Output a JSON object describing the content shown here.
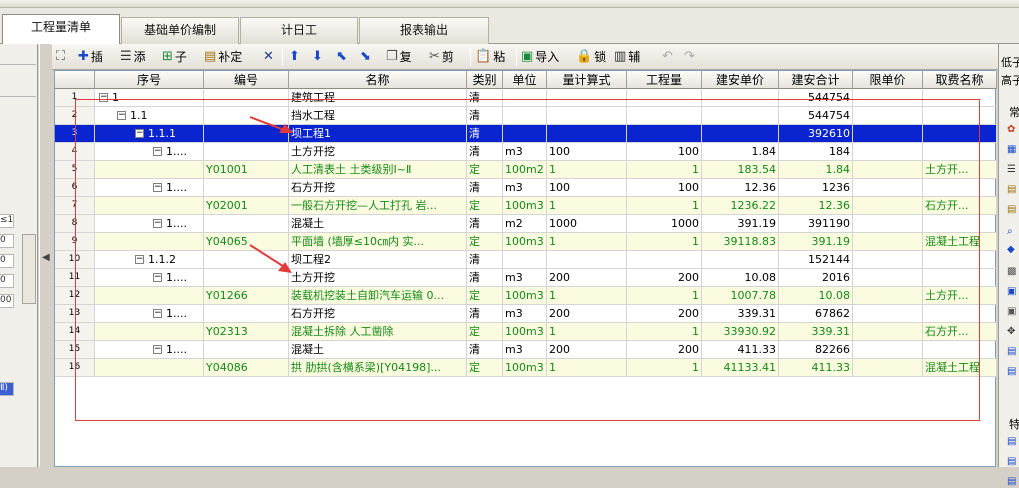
{
  "tabs": [
    {
      "label": "工程量清单"
    },
    {
      "label": "基础单价编制"
    },
    {
      "label": "计日工"
    },
    {
      "label": "报表输出"
    }
  ],
  "left_rows": [
    "≤1(",
    "0㎝",
    "0㎝",
    "0㎝",
    "00",
    "Ⅱ)"
  ],
  "toolbar": {
    "insert": "插",
    "add": "添",
    "child": "子",
    "supplement": "补定",
    "copy": "复",
    "cut": "剪",
    "paste": "粘",
    "import": "导入",
    "lock": "锁",
    "aux": "辅"
  },
  "headers": [
    "序号",
    "编号",
    "名称",
    "类别",
    "单位",
    "量计算式",
    "工程量",
    "建安单价",
    "建安合计",
    "限单价",
    "取费名称"
  ],
  "rows": [
    {
      "n": "1",
      "seq": "1",
      "code": "",
      "name": "建筑工程",
      "cat": "清",
      "unit": "",
      "formula": "",
      "qty": "",
      "price": "",
      "total": "544754",
      "fee": "",
      "type": "q",
      "lvl": 0
    },
    {
      "n": "2",
      "seq": "1.1",
      "code": "",
      "name": "挡水工程",
      "cat": "清",
      "unit": "",
      "formula": "",
      "qty": "",
      "price": "",
      "total": "544754",
      "fee": "",
      "type": "q",
      "lvl": 1
    },
    {
      "n": "3",
      "seq": "1.1.1",
      "code": "",
      "name": "坝工程1",
      "cat": "清",
      "unit": "",
      "formula": "",
      "qty": "",
      "price": "",
      "total": "392610",
      "fee": "",
      "type": "sel",
      "lvl": 2
    },
    {
      "n": "4",
      "seq": "1....",
      "code": "",
      "name": "土方开挖",
      "cat": "清",
      "unit": "m3",
      "formula": "100",
      "qty": "100",
      "price": "1.84",
      "total": "184",
      "fee": "",
      "type": "q",
      "lvl": 3
    },
    {
      "n": "5",
      "seq": "",
      "code": "Y01001",
      "name": "人工清表土 土类级别Ⅰ~Ⅱ",
      "cat": "定",
      "unit": "100m2",
      "formula": "1",
      "qty": "1",
      "price": "183.54",
      "total": "1.84",
      "fee": "土方开...",
      "type": "d",
      "lvl": 4
    },
    {
      "n": "6",
      "seq": "1....",
      "code": "",
      "name": "石方开挖",
      "cat": "清",
      "unit": "m3",
      "formula": "100",
      "qty": "100",
      "price": "12.36",
      "total": "1236",
      "fee": "",
      "type": "q",
      "lvl": 3
    },
    {
      "n": "7",
      "seq": "",
      "code": "Y02001",
      "name": "一般石方开挖—人工打孔 岩...",
      "cat": "定",
      "unit": "100m3",
      "formula": "1",
      "qty": "1",
      "price": "1236.22",
      "total": "12.36",
      "fee": "石方开...",
      "type": "d",
      "lvl": 4
    },
    {
      "n": "8",
      "seq": "1....",
      "code": "",
      "name": "混凝土",
      "cat": "清",
      "unit": "m2",
      "formula": "1000",
      "qty": "1000",
      "price": "391.19",
      "total": "391190",
      "fee": "",
      "type": "q",
      "lvl": 3
    },
    {
      "n": "9",
      "seq": "",
      "code": "Y04065",
      "name": "平面墙 (墙厚≤10㎝内 实...",
      "cat": "定",
      "unit": "100m3",
      "formula": "1",
      "qty": "1",
      "price": "39118.83",
      "total": "391.19",
      "fee": "混凝土工程",
      "type": "d",
      "lvl": 4
    },
    {
      "n": "10",
      "seq": "1.1.2",
      "code": "",
      "name": "坝工程2",
      "cat": "清",
      "unit": "",
      "formula": "",
      "qty": "",
      "price": "",
      "total": "152144",
      "fee": "",
      "type": "q",
      "lvl": 2
    },
    {
      "n": "11",
      "seq": "1....",
      "code": "",
      "name": "土方开挖",
      "cat": "清",
      "unit": "m3",
      "formula": "200",
      "qty": "200",
      "price": "10.08",
      "total": "2016",
      "fee": "",
      "type": "q",
      "lvl": 3
    },
    {
      "n": "12",
      "seq": "",
      "code": "Y01266",
      "name": "装载机挖装土自卸汽车运输 0...",
      "cat": "定",
      "unit": "100m3",
      "formula": "1",
      "qty": "1",
      "price": "1007.78",
      "total": "10.08",
      "fee": "土方开...",
      "type": "d",
      "lvl": 4
    },
    {
      "n": "13",
      "seq": "1....",
      "code": "",
      "name": "石方开挖",
      "cat": "清",
      "unit": "m3",
      "formula": "200",
      "qty": "200",
      "price": "339.31",
      "total": "67862",
      "fee": "",
      "type": "q",
      "lvl": 3
    },
    {
      "n": "14",
      "seq": "",
      "code": "Y02313",
      "name": "混凝土拆除 人工凿除",
      "cat": "定",
      "unit": "100m3",
      "formula": "1",
      "qty": "1",
      "price": "33930.92",
      "total": "339.31",
      "fee": "石方开...",
      "type": "d",
      "lvl": 4
    },
    {
      "n": "15",
      "seq": "1....",
      "code": "",
      "name": "混凝土",
      "cat": "清",
      "unit": "m3",
      "formula": "200",
      "qty": "200",
      "price": "411.33",
      "total": "82266",
      "fee": "",
      "type": "q",
      "lvl": 3
    },
    {
      "n": "16",
      "seq": "",
      "code": "Y04086",
      "name": "拱 肋拱(含横系梁)[Y04198]...",
      "cat": "定",
      "unit": "100m3",
      "formula": "1",
      "qty": "1",
      "price": "41133.41",
      "total": "411.33",
      "fee": "混凝土工程",
      "type": "d",
      "lvl": 4
    }
  ],
  "right_panel": {
    "line1": "低子",
    "line2": "高子",
    "line3": "常",
    "line4": "特"
  },
  "colors": {
    "selected": "#0a24d0",
    "ding_text": "#158a15",
    "ding_bg": "#fbfbe0",
    "annotation": "#e23a3a"
  }
}
